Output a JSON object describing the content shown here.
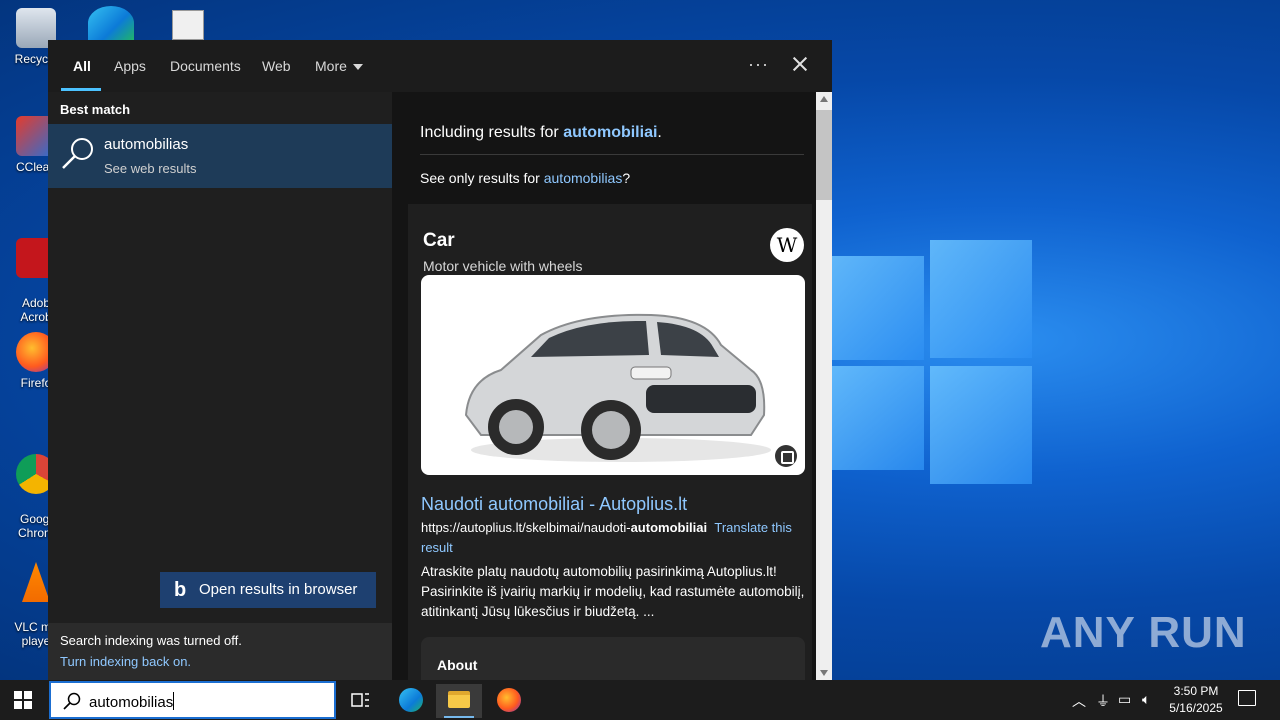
{
  "desktop": {
    "icons": [
      {
        "label": "Recycle"
      },
      {
        "label": "CClean"
      },
      {
        "label": "Adob\nAcrob"
      },
      {
        "label": "Firefo"
      },
      {
        "label": "Googl\nChrom"
      },
      {
        "label": "VLC me\nplaye"
      }
    ],
    "watermark": "ANY RUN"
  },
  "search": {
    "tabs": {
      "all": "All",
      "apps": "Apps",
      "documents": "Documents",
      "web": "Web",
      "more": "More"
    },
    "more_options": "···",
    "best_match_label": "Best match",
    "best_match": {
      "title": "automobilias",
      "subtitle": "See web results"
    },
    "indexing": {
      "message": "Search indexing was turned off.",
      "link": "Turn indexing back on."
    },
    "preview": {
      "including_prefix": "Including results for ",
      "including_term": "automobiliai",
      "including_suffix": ".",
      "see_only_prefix": "See only results for ",
      "see_only_term": "automobilias",
      "see_only_suffix": "?",
      "entity_title": "Car",
      "entity_subtitle": "Motor vehicle with wheels",
      "wiki_logo": "W",
      "result_title": "Naudoti automobiliai - Autoplius.lt",
      "result_url_prefix": "https://autoplius.lt/skelbimai/naudoti-",
      "result_url_bold": "automobiliai",
      "translate_label": "Translate this result",
      "result_description": "Atraskite platų naudotų automobilių pasirinkimą Autoplius.lt! Pasirinkite iš įvairių markių ir modelių, kad rastumėte automobilį, atitinkantį Jūsų lūkesčius ir biudžetą. ...",
      "about_label": "About",
      "open_browser_label": "Open results in browser"
    }
  },
  "taskbar": {
    "search_query": "automobilias",
    "clock_time": "3:50 PM",
    "clock_date": "5/16/2025"
  },
  "colors": {
    "accent": "#4cc2ff",
    "link": "#8fc8ff",
    "selected": "#1e3b58"
  }
}
